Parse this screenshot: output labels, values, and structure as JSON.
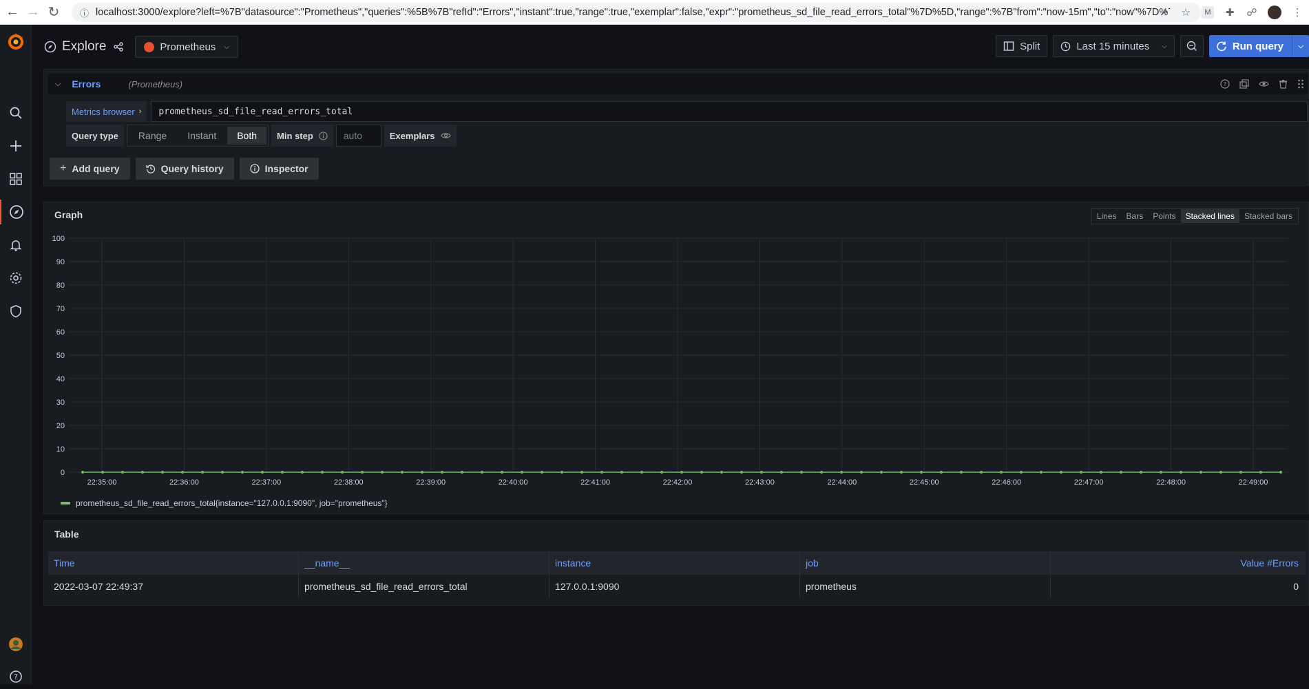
{
  "browser": {
    "url": "localhost:3000/explore?left=%7B\"datasource\":\"Prometheus\",\"queries\":%5B%7B\"refId\":\"Errors\",\"instant\":true,\"range\":true,\"exemplar\":false,\"expr\":\"prometheus_sd_file_read_errors_total\"%7D%5D,\"range\":%7B\"from\":\"now-15m\",\"to\":\"now\"%7D%7D&or..."
  },
  "sidebar": {
    "items": [
      "grafana-logo",
      "search-icon",
      "plus-icon",
      "dashboards-icon",
      "explore-icon",
      "alerting-icon",
      "configuration-icon",
      "shield-icon"
    ],
    "bottom": [
      "user-avatar",
      "help-icon"
    ],
    "accent": "#f05a28"
  },
  "header": {
    "title": "Explore",
    "datasource": "Prometheus",
    "split_label": "Split",
    "time_range": "Last 15 minutes",
    "run_label": "Run query"
  },
  "query": {
    "ref_id": "Errors",
    "datasource_hint": "(Prometheus)",
    "metrics_browser": "Metrics browser",
    "expression": "prometheus_sd_file_read_errors_total",
    "query_type_label": "Query type",
    "query_types": [
      "Range",
      "Instant",
      "Both"
    ],
    "selected_type": "Both",
    "min_step_label": "Min step",
    "min_step_placeholder": "auto",
    "exemplars_label": "Exemplars",
    "buttons": {
      "add_query": "Add query",
      "query_history": "Query history",
      "inspector": "Inspector"
    }
  },
  "graph": {
    "title": "Graph",
    "viz_options": [
      "Lines",
      "Bars",
      "Points",
      "Stacked lines",
      "Stacked bars"
    ],
    "selected_viz": "Stacked lines",
    "legend_label": "prometheus_sd_file_read_errors_total{instance=\"127.0.0.1:9090\", job=\"prometheus\"}",
    "series_color": "#73bf69"
  },
  "chart_data": {
    "type": "line",
    "y_ticks": [
      0,
      10,
      20,
      30,
      40,
      50,
      60,
      70,
      80,
      90,
      100
    ],
    "ylim": [
      0,
      100
    ],
    "x_ticks": [
      "22:35:00",
      "22:36:00",
      "22:37:00",
      "22:38:00",
      "22:39:00",
      "22:40:00",
      "22:41:00",
      "22:42:00",
      "22:43:00",
      "22:44:00",
      "22:45:00",
      "22:46:00",
      "22:47:00",
      "22:48:00",
      "22:49:00"
    ],
    "series": [
      {
        "name": "prometheus_sd_file_read_errors_total{instance=\"127.0.0.1:9090\", job=\"prometheus\"}",
        "values": [
          0,
          0,
          0,
          0,
          0,
          0,
          0,
          0,
          0,
          0,
          0,
          0,
          0,
          0,
          0,
          0,
          0,
          0,
          0,
          0,
          0,
          0,
          0,
          0,
          0,
          0,
          0,
          0,
          0,
          0,
          0,
          0,
          0,
          0,
          0,
          0,
          0,
          0,
          0,
          0,
          0,
          0,
          0,
          0,
          0,
          0,
          0,
          0,
          0,
          0,
          0,
          0,
          0,
          0,
          0,
          0,
          0,
          0,
          0,
          0,
          0
        ]
      }
    ],
    "grid": true
  },
  "table": {
    "title": "Table",
    "columns": [
      "Time",
      "__name__",
      "instance",
      "job",
      "Value #Errors"
    ],
    "rows": [
      [
        "2022-03-07 22:49:37",
        "prometheus_sd_file_read_errors_total",
        "127.0.0.1:9090",
        "prometheus",
        "0"
      ]
    ]
  }
}
